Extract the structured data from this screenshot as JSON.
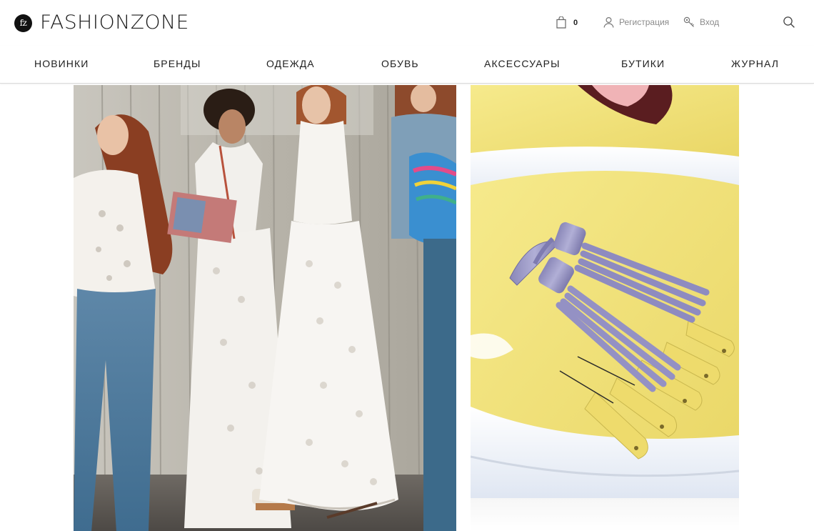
{
  "header": {
    "logo_mark": "fz",
    "logo_text": "FASHIONZONE",
    "cart_count": "0",
    "register_label": "Регистрация",
    "login_label": "Вход"
  },
  "nav": {
    "items": [
      {
        "label": "НОВИНКИ"
      },
      {
        "label": "БРЕНДЫ"
      },
      {
        "label": "ОДЕЖДА"
      },
      {
        "label": "ОБУВЬ"
      },
      {
        "label": "АКСЕССУАРЫ"
      },
      {
        "label": "БУТИКИ"
      },
      {
        "label": "ЖУРНАЛ"
      }
    ]
  },
  "icons": {
    "cart": "shopping-bag-icon",
    "register": "user-icon",
    "login": "key-icon",
    "search": "search-icon"
  },
  "colors": {
    "text": "#1e1e1e",
    "muted_link": "#8a8a8a",
    "nav_border": "#d9d9d9",
    "shoe_yellow": "#f2e27a",
    "tassel_lavender": "#9a98c4"
  }
}
